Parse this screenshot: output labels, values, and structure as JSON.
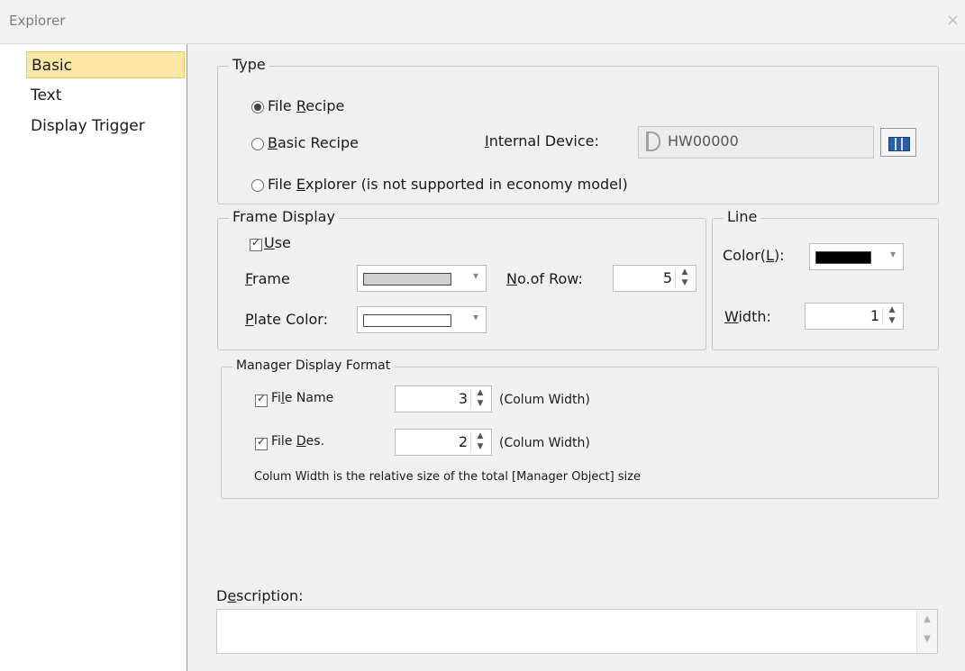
{
  "window": {
    "title": "Explorer",
    "close": "×"
  },
  "sidebar": {
    "items": [
      {
        "label": "Basic"
      },
      {
        "label": "Text"
      },
      {
        "label": "Display Trigger"
      }
    ]
  },
  "type_group": {
    "legend": "Type",
    "file_recipe": {
      "pre": "File ",
      "key": "R",
      "post": "ecipe"
    },
    "basic_recipe": {
      "pre": "",
      "key": "B",
      "post": "asic Recipe"
    },
    "file_explorer": {
      "pre": "File ",
      "key": "E",
      "post": "xplorer (is not supported in economy model)"
    },
    "internal_device": {
      "pre": "",
      "key": "I",
      "post": "nternal Device:"
    },
    "device_value": "HW00000"
  },
  "frame_display": {
    "legend": "Frame Display",
    "use": {
      "pre": "",
      "key": "U",
      "post": "se"
    },
    "frame": {
      "pre": "",
      "key": "F",
      "post": "rame"
    },
    "no_of_row": {
      "pre": "",
      "key": "N",
      "post": "o.of Row:"
    },
    "no_of_row_value": "5",
    "plate_color": {
      "pre": "",
      "key": "P",
      "post": "late Color:"
    },
    "frame_color": "#d0d0d0",
    "plate_color_value": "#ffffff"
  },
  "line_group": {
    "legend": "Line",
    "color": {
      "pre": "Color(",
      "key": "L",
      "post": "):"
    },
    "color_value": "#000000",
    "width": {
      "pre": "",
      "key": "W",
      "post": "idth:"
    },
    "width_value": "1"
  },
  "manager_format": {
    "legend": "Manager Display Format",
    "file_name": {
      "pre": "Fi",
      "key": "l",
      "post": "e Name"
    },
    "file_name_value": "3",
    "file_des": {
      "pre": "File ",
      "key": "D",
      "post": "es."
    },
    "file_des_value": "2",
    "colum_width": "(Colum Width)",
    "note": "Colum Width is the relative size of the total [Manager Object] size"
  },
  "description": {
    "pre": "D",
    "key": "e",
    "post": "scription:"
  }
}
